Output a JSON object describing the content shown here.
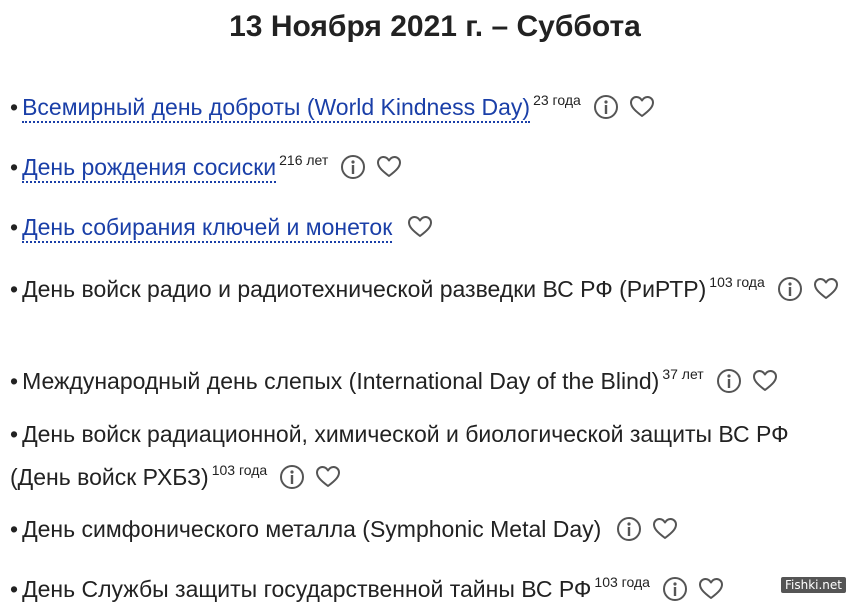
{
  "page": {
    "title": "13 Ноября 2021 г. – Суббота"
  },
  "holidays": [
    {
      "bullet": "•",
      "name": "Всемирный день доброты (World Kindness Day)",
      "age": "23 года",
      "linked": true
    },
    {
      "bullet": "•",
      "name": "День рождения сосиски",
      "age": "216 лет",
      "linked": true
    },
    {
      "bullet": "•",
      "name": "День собирания ключей и монеток",
      "age": "",
      "linked": true
    },
    {
      "bullet": "•",
      "name": "День войск радио и радиотехнической разведки ВС РФ (РиРТР)",
      "age": "103 года",
      "linked": false
    },
    {
      "bullet": "•",
      "name": "Международный день слепых (International Day of the Blind)",
      "age": "37 лет",
      "linked": false
    },
    {
      "bullet": "•",
      "name": "День войск радиационной, химической и биологической защиты ВС РФ (День войск РХБЗ)",
      "age": "103 года",
      "linked": false
    },
    {
      "bullet": "•",
      "name": "День симфонического металла (Symphonic Metal Day)",
      "age": "",
      "linked": false
    },
    {
      "bullet": "•",
      "name": "День Службы защиты государственной тайны ВС РФ",
      "age": "103 года",
      "linked": false
    }
  ],
  "icons": {
    "info": "info-icon",
    "favorite": "heart-icon"
  },
  "colors": {
    "link": "#1a3fa8",
    "text": "#222222",
    "icon": "#555555"
  },
  "watermark": "Fishki.net"
}
